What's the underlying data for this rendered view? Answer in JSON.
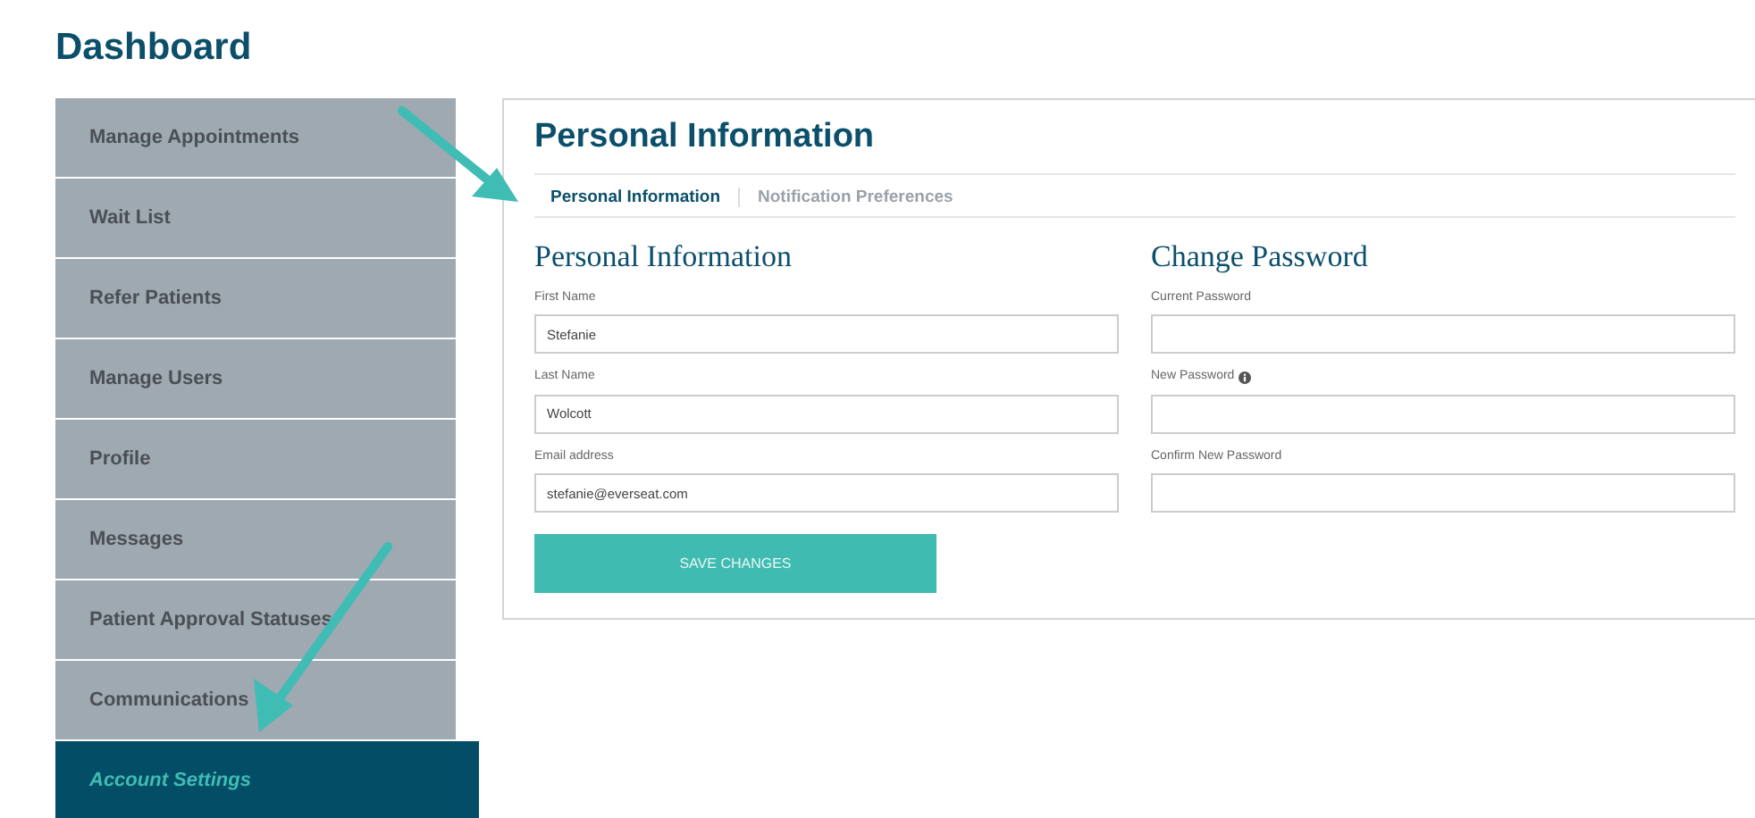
{
  "page_title": "Dashboard",
  "sidebar": {
    "items": [
      {
        "label": "Manage Appointments",
        "selected": false
      },
      {
        "label": "Wait List",
        "selected": false
      },
      {
        "label": "Refer Patients",
        "selected": false
      },
      {
        "label": "Manage Users",
        "selected": false
      },
      {
        "label": "Profile",
        "selected": false
      },
      {
        "label": "Messages",
        "selected": false
      },
      {
        "label": "Patient Approval Statuses",
        "selected": false
      },
      {
        "label": "Communications",
        "selected": false
      },
      {
        "label": "Account Settings",
        "selected": true
      }
    ]
  },
  "panel": {
    "title": "Personal Information",
    "tabs": [
      {
        "label": "Personal Information",
        "selected": true
      },
      {
        "label": "Notification Preferences",
        "selected": false
      }
    ],
    "sections": [
      {
        "heading": "Personal Information",
        "fields": [
          {
            "label": "First Name",
            "value": "Stefanie"
          },
          {
            "label": "Last Name",
            "value": "Wolcott"
          },
          {
            "label": "Email address",
            "value": "stefanie@everseat.com"
          }
        ],
        "button": "SAVE CHANGES"
      },
      {
        "heading": "Change Password",
        "fields": [
          {
            "label": "Current Password"
          },
          {
            "label": "New Password",
            "info": true
          },
          {
            "label": "Confirm New Password"
          }
        ]
      }
    ]
  }
}
